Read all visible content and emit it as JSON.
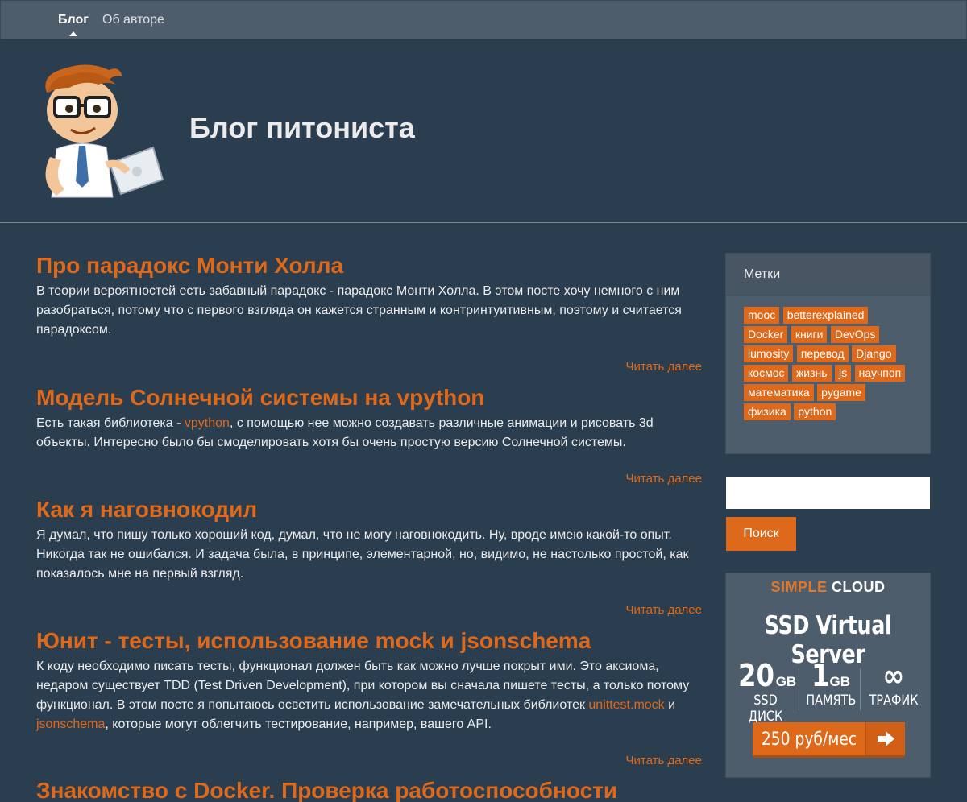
{
  "nav": {
    "items": [
      {
        "label": "Блог",
        "active": true
      },
      {
        "label": "Об авторе",
        "active": false
      }
    ]
  },
  "header": {
    "title": "Блог питониста"
  },
  "posts": [
    {
      "title": "Про парадокс Монти Холла",
      "body": "В теории вероятностей есть забавный парадокс - парадокс Монти Холла. В этом посте хочу немного с ним разобраться, потому что с первого взгляда он кажется странным и контринтуитивным, поэтому и считается парадоксом.",
      "read_more": "Читать далее"
    },
    {
      "title": "Модель Солнечной системы на vpython",
      "body_before": "Есть такая библиотека - ",
      "body_link": "vpython",
      "body_after": ", с помощью нее можно создавать различные анимации и рисовать 3d объекты. Интересно было бы смоделировать хотя бы очень простую версию Солнечной системы.",
      "read_more": "Читать далее"
    },
    {
      "title": "Как я наговнокодил",
      "body": "Я думал, что пишу только хороший код, думал, что не могу наговнокодить. Ну, вроде имею какой-то опыт. Никогда так не ошибался. И задача была, в принципе, элементарной, но, видимо, не настолько простой, как показалось мне на первый взгляд.",
      "read_more": "Читать далее"
    },
    {
      "title": "Юнит - тесты, использование mock и jsonschema",
      "body_before": "К коду необходимо писать тесты, функционал должен быть как можно лучше покрыт ими. Это аксиома, недаром существует TDD (Test Driven Development), при котором вы сначала пишете тесты, а только потому функционал. В этом посте я попытаюсь осветить использование замечательных библиотек ",
      "body_link1": "unittest.mock",
      "body_mid": " и ",
      "body_link2": "jsonschema",
      "body_after": ", которые могут облегчить тестирование, например, вашего API.",
      "read_more": "Читать далее"
    },
    {
      "title": "Знакомство с Docker. Проверка работоспособности"
    }
  ],
  "sidebar": {
    "tags_heading": "Метки",
    "tags": [
      "mooc",
      "betterexplained",
      "Docker",
      "книги",
      "DevOps",
      "lumosity",
      "перевод",
      "Django",
      "космос",
      "жизнь",
      "js",
      "научпоп",
      "математика",
      "pygame",
      "физика",
      "python"
    ],
    "search_value": "",
    "search_button": "Поиск"
  },
  "ad": {
    "brand_part1": "SIMPLE",
    "brand_part2": "CLOUD",
    "headline": "SSD Virtual Server",
    "stats": [
      {
        "value": "20",
        "unit": "GB",
        "label": "SSD ДИСК"
      },
      {
        "value": "1",
        "unit": "GB",
        "label": "ПАМЯТЬ"
      },
      {
        "value": "∞",
        "unit": "",
        "label": "ТРАФИК"
      }
    ],
    "price": "250 руб/мес",
    "colors": {
      "accent": "#df691a",
      "background": "#2b3e50",
      "panel": "#4e5d6c"
    }
  }
}
